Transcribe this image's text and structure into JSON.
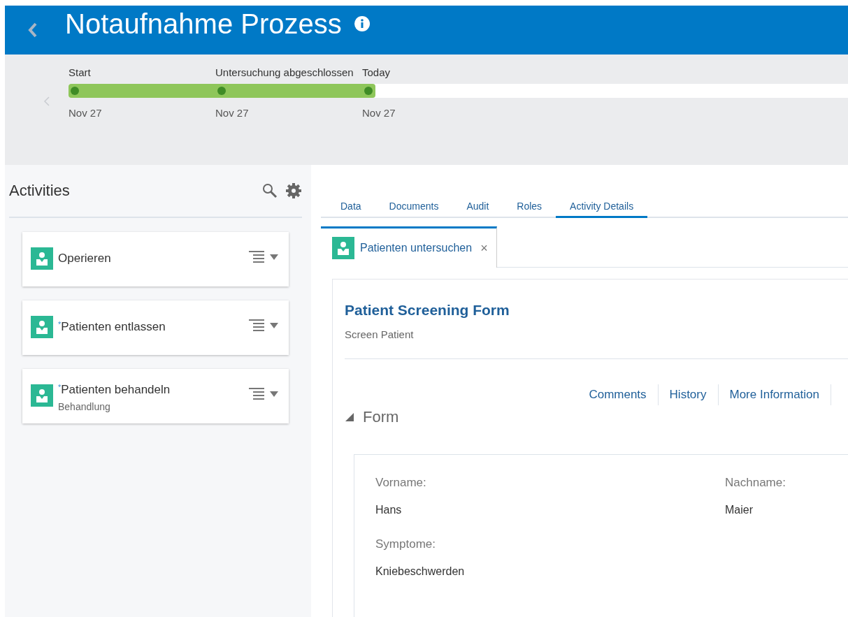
{
  "header": {
    "title": "Notaufnahme Prozess"
  },
  "timeline": {
    "level": 0.394,
    "milestones": [
      {
        "label": "Start",
        "date": "Nov 27"
      },
      {
        "label": "Untersuchung abgeschlossen",
        "date": "Nov 27"
      },
      {
        "label": "Today",
        "date": "Nov 27"
      }
    ]
  },
  "activities": {
    "title": "Activities",
    "items": [
      {
        "name": "Operieren"
      },
      {
        "required_mark": "*",
        "name": "Patienten entlassen"
      },
      {
        "required_mark": "*",
        "name": "Patienten behandeln",
        "subtitle": "Behandlung"
      }
    ]
  },
  "tabs": [
    {
      "label": "Data",
      "selected": false
    },
    {
      "label": "Documents",
      "selected": false
    },
    {
      "label": "Audit",
      "selected": false
    },
    {
      "label": "Roles",
      "selected": false
    },
    {
      "label": "Activity Details",
      "selected": true
    }
  ],
  "subtab": {
    "label": "Patienten untersuchen",
    "close": "×"
  },
  "form": {
    "title": "Patient Screening Form",
    "subtitle": "Screen Patient",
    "links": [
      "Comments",
      "History",
      "More Information"
    ],
    "section": {
      "title": "Form",
      "expanded": true
    },
    "fields": [
      {
        "label": "Vorname:",
        "value": "Hans"
      },
      {
        "label": "Nachname:",
        "value": "Maier"
      },
      {
        "label": "Symptome:",
        "value": "Kniebeschwerden"
      }
    ]
  }
}
